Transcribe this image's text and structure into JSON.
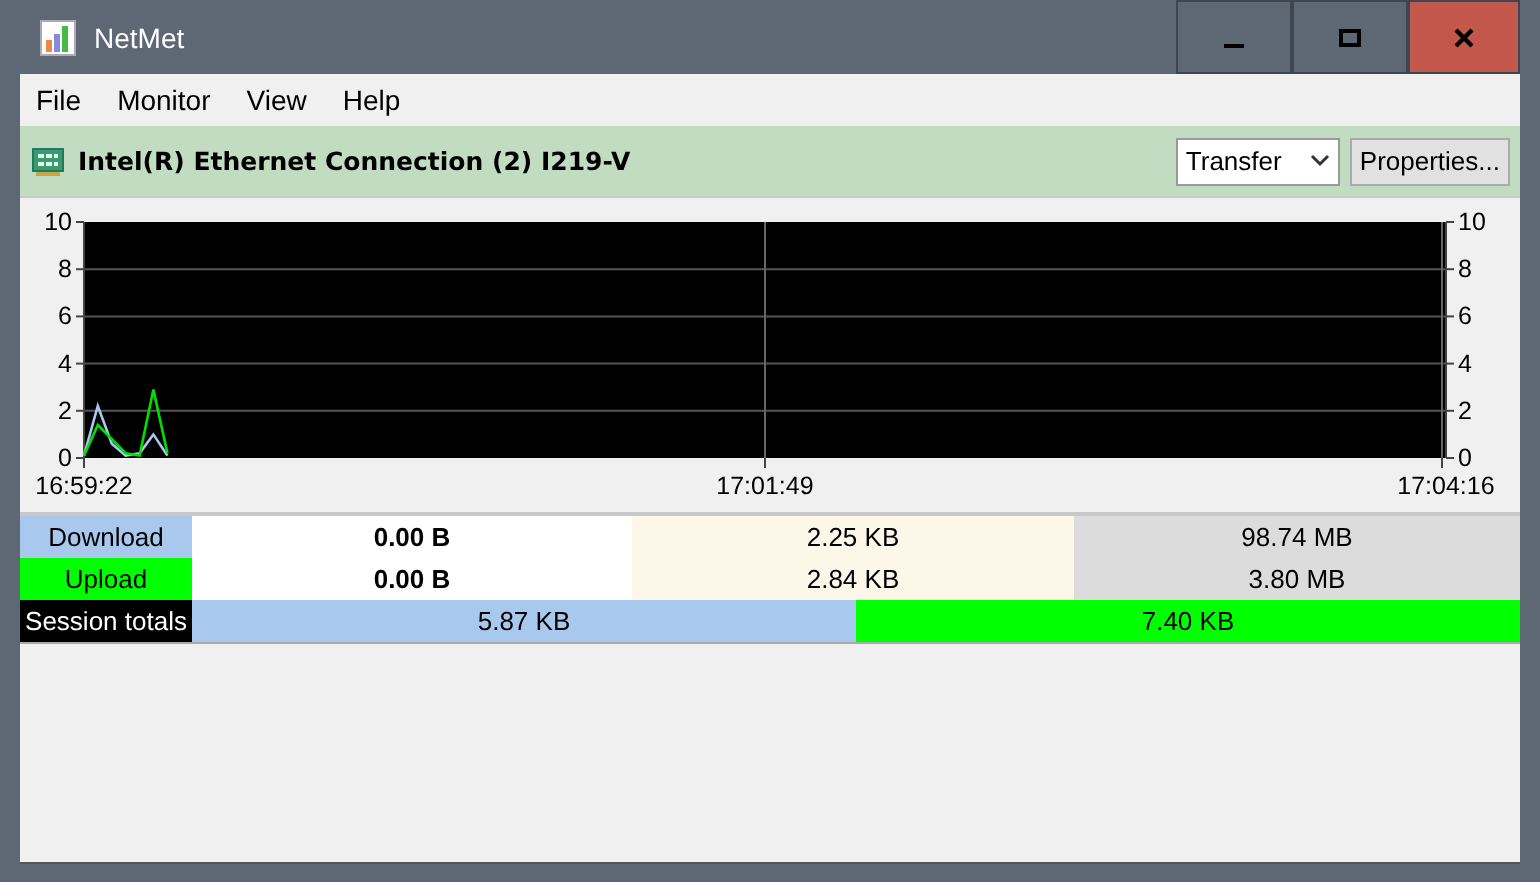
{
  "window": {
    "title": "NetMet"
  },
  "menu": [
    {
      "label": "File"
    },
    {
      "label": "Monitor"
    },
    {
      "label": "View"
    },
    {
      "label": "Help"
    }
  ],
  "adapter": {
    "name": "Intel(R) Ethernet Connection (2) I219-V",
    "mode": "Transfer",
    "properties_button": "Properties..."
  },
  "chart_data": {
    "type": "line",
    "grid": true,
    "ylim": [
      0,
      10
    ],
    "yticks": [
      0,
      2,
      4,
      6,
      8,
      10
    ],
    "categories": [
      "16:59:22",
      null,
      null,
      null,
      null,
      null,
      null,
      null,
      null,
      null,
      null,
      null,
      null,
      null,
      null,
      null,
      null,
      null,
      null,
      null,
      null,
      null,
      null,
      null,
      null,
      null,
      null,
      null,
      null,
      null,
      null,
      null,
      null,
      null,
      null,
      null,
      null,
      null,
      null,
      null,
      null,
      null,
      null,
      null,
      null,
      null,
      null,
      null,
      null,
      "17:01:49",
      null,
      null,
      null,
      null,
      null,
      null,
      null,
      null,
      null,
      null,
      null,
      null,
      null,
      null,
      null,
      null,
      null,
      null,
      null,
      null,
      null,
      null,
      null,
      null,
      null,
      null,
      null,
      null,
      null,
      null,
      null,
      null,
      null,
      null,
      null,
      null,
      null,
      null,
      null,
      null,
      null,
      null,
      null,
      null,
      null,
      null,
      null,
      null,
      "17:04:16"
    ],
    "series": [
      {
        "color": "#a8c8ee",
        "values": [
          0.1,
          2.2,
          0.6,
          0.1,
          0.2,
          1.0,
          0.1,
          null,
          null,
          null,
          null,
          null,
          null,
          null,
          null,
          null,
          null,
          null,
          null,
          null,
          null,
          null,
          null,
          null,
          null,
          null,
          null,
          null,
          null,
          null,
          null,
          null,
          null,
          null,
          null,
          null,
          null,
          null,
          null,
          null,
          null,
          null,
          null,
          null,
          null,
          null,
          null,
          null,
          null,
          null,
          null,
          null,
          null,
          null,
          null,
          null,
          null,
          null,
          null,
          null,
          null,
          null,
          null,
          null,
          null,
          null,
          null,
          null,
          null,
          null,
          null,
          null,
          null,
          null,
          null,
          null,
          null,
          null,
          null,
          null,
          null,
          null,
          null,
          null,
          null,
          null,
          null,
          null,
          null,
          null,
          null,
          null,
          null,
          null,
          null,
          null,
          null,
          null,
          null
        ]
      },
      {
        "color": "#00e000",
        "values": [
          0.1,
          1.4,
          0.8,
          0.2,
          0.1,
          2.9,
          0.2,
          null,
          null,
          null,
          null,
          null,
          null,
          null,
          null,
          null,
          null,
          null,
          null,
          null,
          null,
          null,
          null,
          null,
          null,
          null,
          null,
          null,
          null,
          null,
          null,
          null,
          null,
          null,
          null,
          null,
          null,
          null,
          null,
          null,
          null,
          null,
          null,
          null,
          null,
          null,
          null,
          null,
          null,
          null,
          null,
          null,
          null,
          null,
          null,
          null,
          null,
          null,
          null,
          null,
          null,
          null,
          null,
          null,
          null,
          null,
          null,
          null,
          null,
          null,
          null,
          null,
          null,
          null,
          null,
          null,
          null,
          null,
          null,
          null,
          null,
          null,
          null,
          null,
          null,
          null,
          null,
          null,
          null,
          null,
          null,
          null,
          null,
          null,
          null,
          null,
          null,
          null,
          null
        ]
      }
    ]
  },
  "chart_right_axis_labels": [
    "10",
    "8",
    "6",
    "4",
    "2",
    "0"
  ],
  "rows": [
    {
      "label": "Download",
      "color": "#a8c8ee",
      "current": "0.00 B",
      "column_3": "2.25 KB",
      "column_4": "98.74 MB"
    },
    {
      "label": "Upload",
      "color": "#00ff00",
      "current": "0.00 B",
      "column_3": "2.84 KB",
      "column_4": "3.80 MB"
    }
  ],
  "session_totals": {
    "label": "Session totals",
    "download": "5.87 KB",
    "upload": "7.40 KB"
  }
}
